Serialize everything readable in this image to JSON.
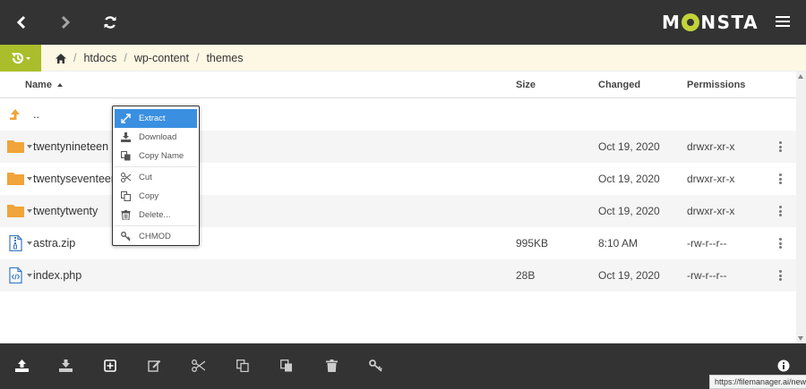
{
  "app": {
    "logo_text_a": "M",
    "logo_text_b": "NSTA"
  },
  "breadcrumb": {
    "items": [
      "htdocs",
      "wp-content",
      "themes"
    ],
    "separator": "/"
  },
  "columns": {
    "name": "Name",
    "size": "Size",
    "changed": "Changed",
    "permissions": "Permissions"
  },
  "files": [
    {
      "name": "..",
      "size": "",
      "changed": "",
      "permissions": "",
      "icon": "parent-folder-icon"
    },
    {
      "name": "twentynineteen",
      "size": "",
      "changed": "Oct 19, 2020",
      "permissions": "drwxr-xr-x",
      "icon": "folder-icon"
    },
    {
      "name": "twentyseventeen",
      "size": "",
      "changed": "Oct 19, 2020",
      "permissions": "drwxr-xr-x",
      "icon": "folder-icon"
    },
    {
      "name": "twentytwenty",
      "size": "",
      "changed": "Oct 19, 2020",
      "permissions": "drwxr-xr-x",
      "icon": "folder-icon"
    },
    {
      "name": "astra.zip",
      "size": "995KB",
      "changed": "8:10 AM",
      "permissions": "-rw-r--r--",
      "icon": "zip-file-icon"
    },
    {
      "name": "index.php",
      "size": "28B",
      "changed": "Oct 19, 2020",
      "permissions": "-rw-r--r--",
      "icon": "code-file-icon"
    }
  ],
  "context_menu": {
    "items": [
      "Extract",
      "Download",
      "Copy Name",
      "Cut",
      "Copy",
      "Delete...",
      "CHMOD"
    ]
  },
  "status_tip": "https://filemanager.ai/new/#",
  "colors": {
    "topbar": "#333333",
    "accent_green": "#a9be2a",
    "folder": "#f0a43a",
    "file_icon": "#3a78c2",
    "menu_active": "#3a8fe0"
  }
}
